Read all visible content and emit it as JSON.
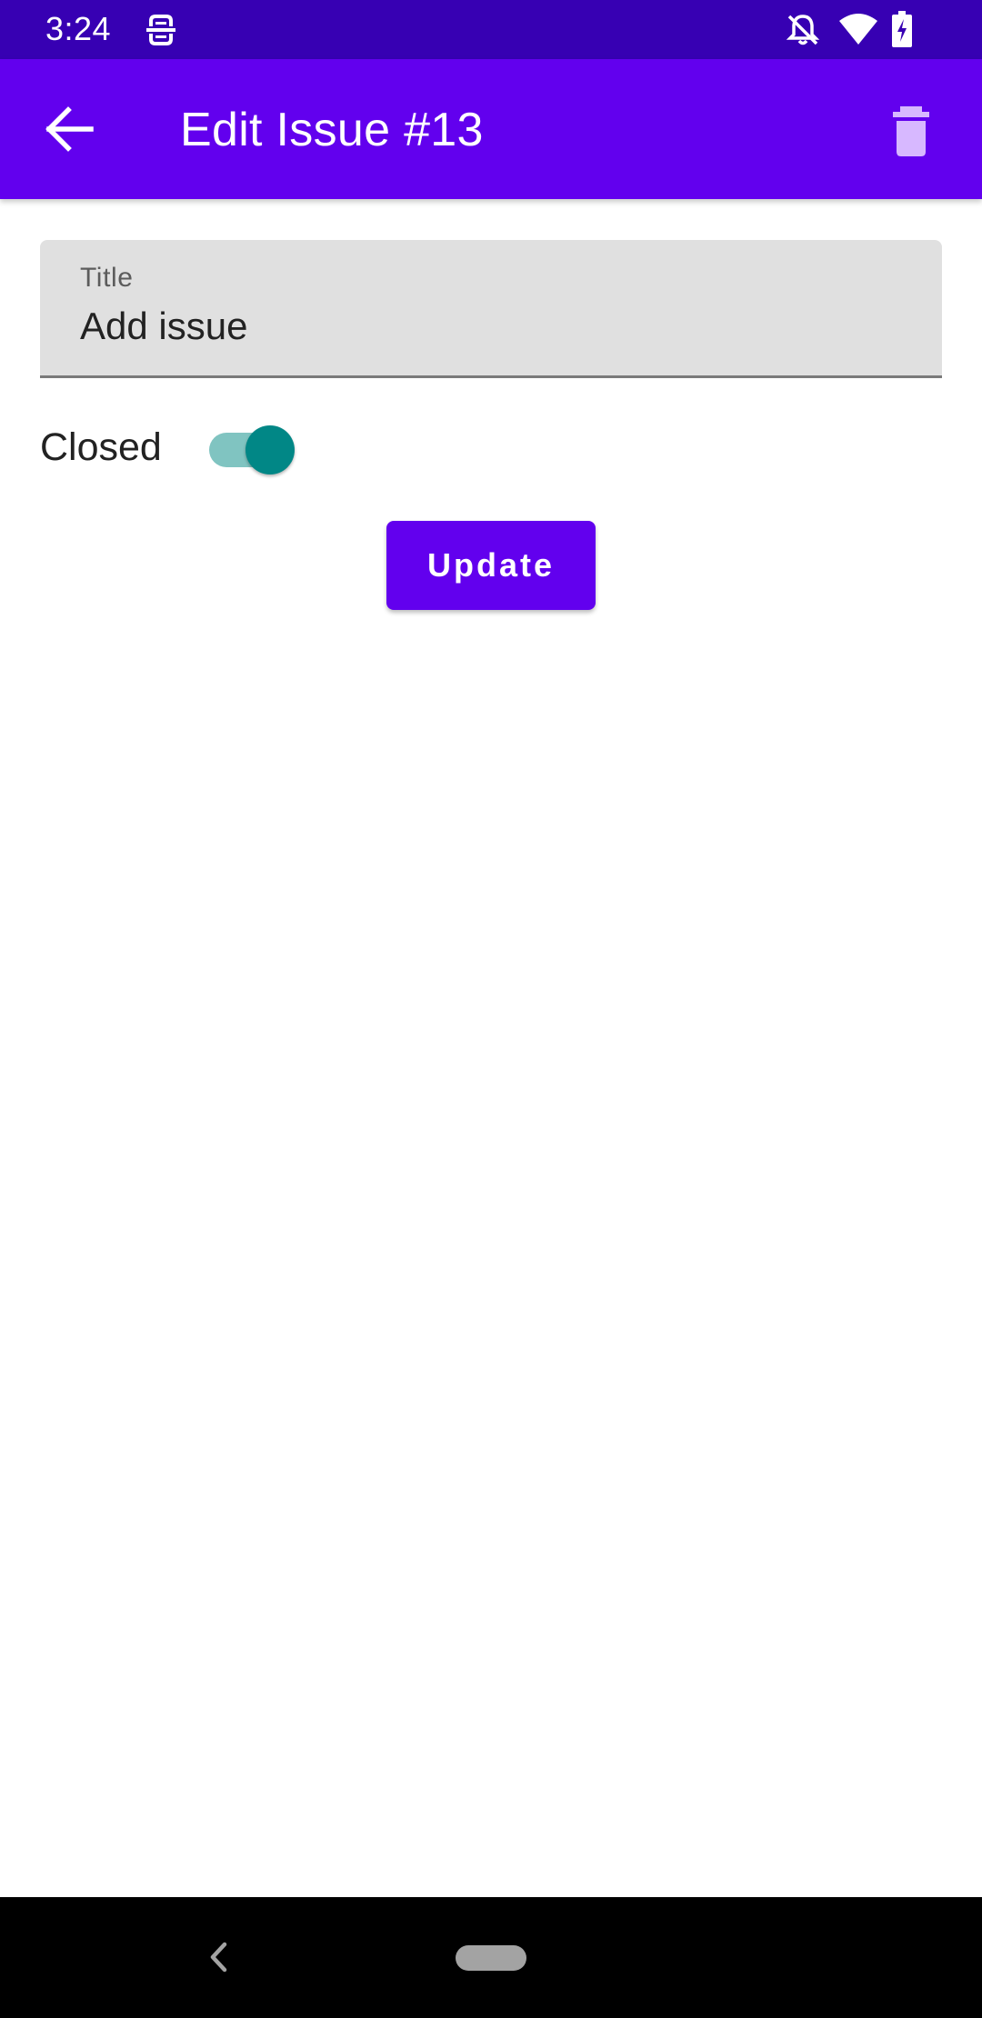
{
  "status_bar": {
    "time": "3:24",
    "icons": [
      "drive-icon",
      "notifications-off-icon",
      "wifi-icon",
      "battery-charging-icon"
    ]
  },
  "app_bar": {
    "title": "Edit Issue #13",
    "back_icon": "arrow-left-icon",
    "delete_icon": "trash-icon",
    "background_color": "#6200ee"
  },
  "form": {
    "title_field": {
      "label": "Title",
      "value": "Add issue"
    },
    "closed_switch": {
      "label": "Closed",
      "checked": true,
      "accent_color": "#018786"
    },
    "update_button": {
      "label": "Update"
    }
  },
  "nav_bar": {
    "back_icon": "nav-back-icon",
    "home_icon": "nav-home-pill"
  }
}
